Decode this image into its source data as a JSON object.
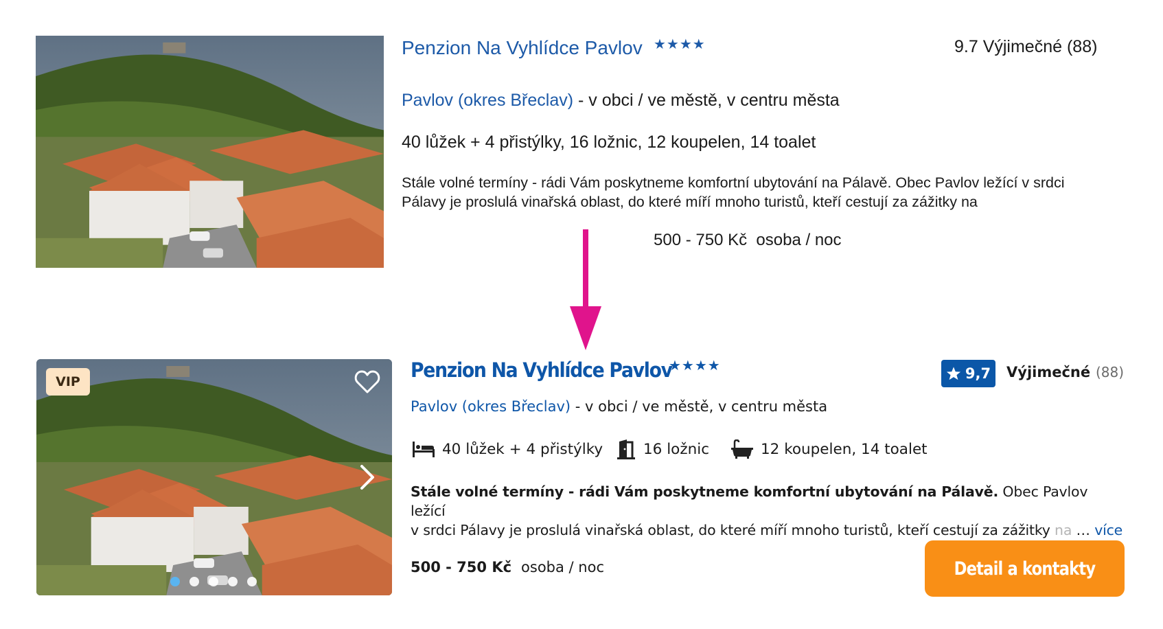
{
  "old_card": {
    "title": "Penzion Na Vyhlídce Pavlov",
    "stars": "★★★★",
    "rating": "9.7 Výjimečné (88)",
    "location_link": "Pavlov (okres Břeclav)",
    "location_rest": " - v obci / ve městě, v centru města",
    "beds_info": "40 lůžek + 4 přistýlky, 16 ložnic, 12 koupelen, 14 toalet",
    "description": "Stále volné termíny - rádi Vám poskytneme komfortní ubytování na Pálavě. Obec Pavlov ležící v srdci Pálavy je proslulá vinařská oblast, do které míří mnoho turistů, kteří cestují za zážitky na",
    "price": "500 - 750 Kč  osoba / noc"
  },
  "new_card": {
    "badge": "VIP",
    "title": "Penzion Na Vyhlídce Pavlov",
    "stars": "★★★★",
    "score": "9,7",
    "rating_word": "Výjimečné",
    "rating_count": "(88)",
    "location_link": "Pavlov (okres Břeclav)",
    "location_rest": " - v obci / ve městě, v centru města",
    "features": {
      "beds": "40 lůžek + 4 přistýlky",
      "rooms": "16 ložnic",
      "baths": "12 koupelen, 14 toalet"
    },
    "description_bold": "Stále volné termíny - rádi Vám poskytneme komfortní ubytování na Pálavě.",
    "description_line1_rest": " Obec Pavlov ležící",
    "description_line2": "v srdci Pálavy je proslulá vinařská oblast, do které míří mnoho turistů, kteří cestují za zážitky",
    "description_fade": " na",
    "more_ellipsis": "…",
    "more_label": "více",
    "price_amount": "500 - 750 Kč",
    "price_unit": "osoba / noc",
    "cta_label": "Detail a kontakty",
    "carousel": {
      "total": 5,
      "active": 0
    },
    "icons": [
      "heart-icon",
      "chevron-right-icon",
      "bed-icon",
      "door-icon",
      "bathtub-icon",
      "star-icon"
    ]
  },
  "colors": {
    "link_blue": "#1d5aa8",
    "brand_blue": "#0b57a8",
    "cta_orange": "#f98f16",
    "arrow_magenta": "#e0148c",
    "vip_bg": "#fde4c4"
  }
}
